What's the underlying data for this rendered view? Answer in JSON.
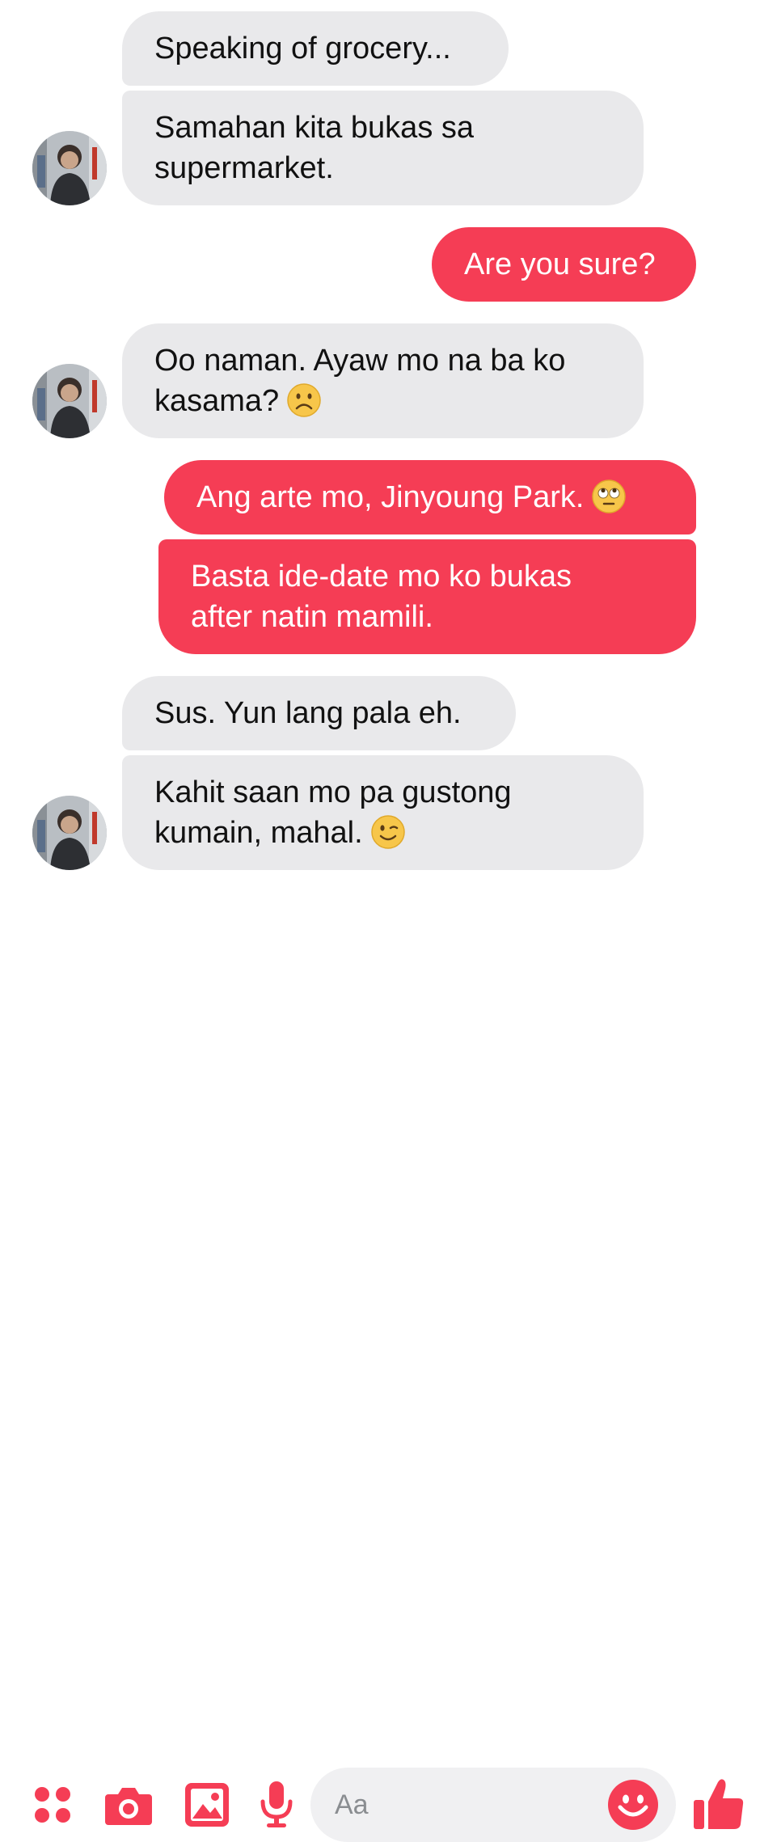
{
  "accent_color": "#f53d55",
  "incoming_bubble_color": "#e9e9eb",
  "messages": [
    {
      "side": "in",
      "lines": [
        "Speaking of grocery..."
      ]
    },
    {
      "side": "in",
      "lines": [
        "Samahan kita bukas sa",
        "supermarket."
      ]
    },
    {
      "side": "out",
      "lines": [
        "Are you sure?"
      ]
    },
    {
      "side": "in",
      "lines": [
        "Oo naman. Ayaw mo na ba ko",
        "kasama?"
      ],
      "emoji": "frowning-face"
    },
    {
      "side": "out",
      "lines": [
        "Ang arte mo, Jinyoung Park."
      ],
      "emoji": "eye-roll-face"
    },
    {
      "side": "out",
      "lines": [
        "Basta ide-date mo ko bukas",
        "after natin mamili."
      ]
    },
    {
      "side": "in",
      "lines": [
        "Sus. Yun lang pala eh."
      ]
    },
    {
      "side": "in",
      "lines": [
        "Kahit saan mo pa gustong",
        "kumain, mahal."
      ],
      "emoji": "winking-face"
    }
  ],
  "composer": {
    "placeholder": "Aa",
    "icons": [
      "apps-grid-icon",
      "camera-icon",
      "image-icon",
      "microphone-icon",
      "emoji-icon",
      "thumbs-up-icon"
    ]
  }
}
